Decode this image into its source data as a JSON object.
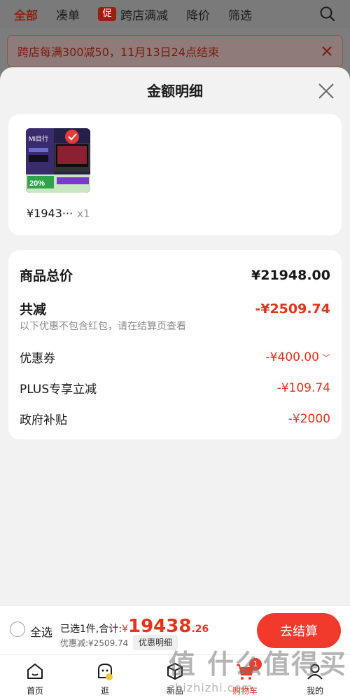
{
  "topbar": {
    "tabs": [
      {
        "label": "全部",
        "active": true
      },
      {
        "label": "凑单",
        "active": false
      },
      {
        "label": "跨店满减",
        "active": false,
        "tag": "促"
      },
      {
        "label": "降价",
        "active": false
      },
      {
        "label": "筛选",
        "active": false
      }
    ]
  },
  "notice": {
    "text": "跨店每满300减50，11月13日24点结束"
  },
  "sheet": {
    "title": "金额明细",
    "product": {
      "price": "¥1943···",
      "qty": "x1"
    },
    "summary": {
      "total_label": "商品总价",
      "total_value": "¥21948.00",
      "reduce_label": "共减",
      "reduce_value": "-¥2509.74",
      "note": "以下优惠不包含红包，请在结算页查看",
      "items": [
        {
          "label": "优惠券",
          "value": "-¥400.00",
          "expandable": true
        },
        {
          "label": "PLUS专享立减",
          "value": "-¥109.74",
          "expandable": false
        },
        {
          "label": "政府补贴",
          "value": "-¥2000",
          "expandable": false
        }
      ]
    }
  },
  "bottom": {
    "select_all": "全选",
    "selected_text": "已选1件,合计:",
    "yen": "¥",
    "total_int": "19438",
    "total_dec": ".26",
    "discount_text": "优惠减:¥2509.74",
    "detail_btn": "优惠明细",
    "checkout_btn": "去结算"
  },
  "nav": [
    {
      "label": "首页",
      "icon": "home-icon"
    },
    {
      "label": "逛",
      "icon": "browse-icon"
    },
    {
      "label": "新品",
      "icon": "new-product-icon"
    },
    {
      "label": "购物车",
      "icon": "cart-icon",
      "badge": "1"
    },
    {
      "label": "我的",
      "icon": "profile-icon"
    }
  ],
  "watermark": {
    "big": "值 什么值得买",
    "small": "zhizhizhi.com"
  },
  "colors": {
    "accent": "#e4341c",
    "checkout": "#f23a2c"
  }
}
